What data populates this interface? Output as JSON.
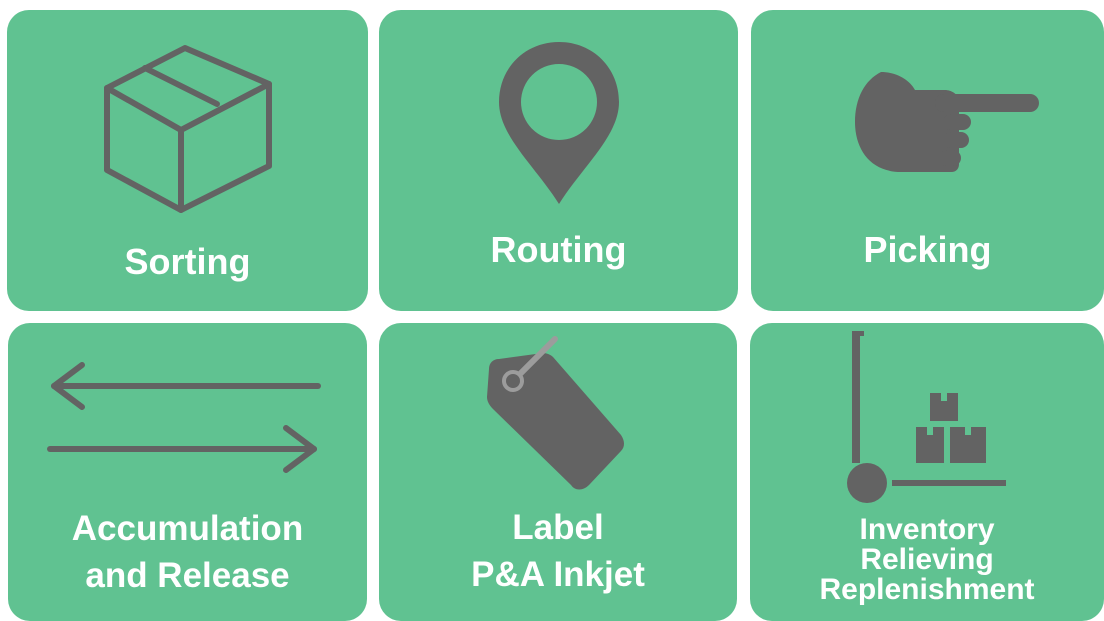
{
  "colors": {
    "tile": "#60c291",
    "icon": "#636363",
    "label": "#ffffff",
    "tag_ring": "#9c9c9c"
  },
  "tiles": [
    {
      "label": "Sorting",
      "icon": "box-icon"
    },
    {
      "label": "Routing",
      "icon": "map-pin-icon"
    },
    {
      "label": "Picking",
      "icon": "pointing-hand-icon"
    },
    {
      "label": "Accumulation\nand Release",
      "icon": "two-way-arrows-icon"
    },
    {
      "label": "Label\nP&A Inkjet",
      "icon": "tag-icon"
    },
    {
      "label": "Inventory\nRelieving\nReplenishment",
      "icon": "hand-truck-boxes-icon"
    }
  ]
}
